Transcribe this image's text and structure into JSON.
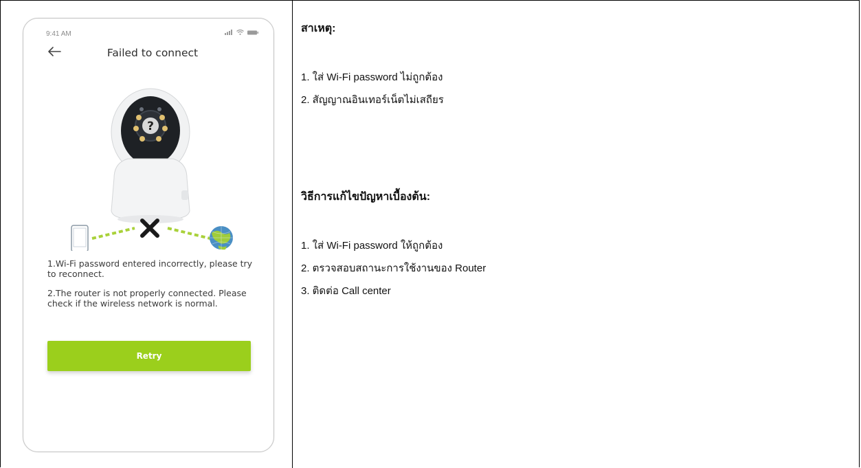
{
  "phone": {
    "status_time": "9:41 AM",
    "title": "Failed to connect",
    "reasons": [
      "1.Wi-Fi password entered incorrectly, please try to reconnect.",
      "2.The router is not properly connected. Please check if the wireless network is normal."
    ],
    "retry_label": "Retry",
    "accent_color": "#9bcf1c",
    "question_mark": "?"
  },
  "causes": {
    "heading": "สาเหตุ:",
    "items": [
      "1. ใส่ Wi-Fi password ไม่ถูกต้อง",
      "2. สัญญาณอินเทอร์เน็ตไม่เสถียร"
    ]
  },
  "solutions": {
    "heading": "วิธีการแก้ไขปัญหาเบื้องต้น:",
    "items": [
      "1. ใส่ Wi-Fi password ให้ถูกต้อง",
      "2. ตรวจสอบสถานะการใช้งานของ Router",
      "3. ติดต่อ Call center"
    ]
  }
}
